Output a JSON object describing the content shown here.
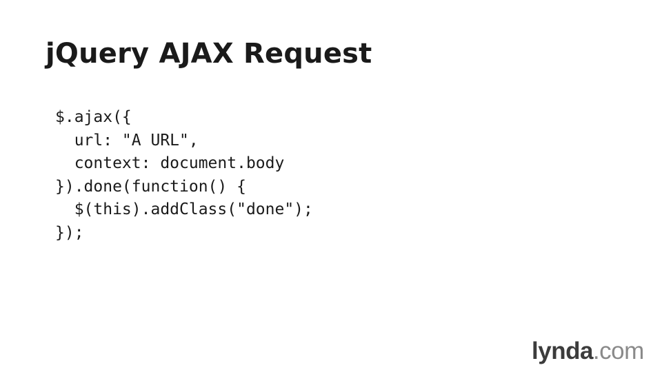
{
  "slide": {
    "title": "jQuery AJAX Request",
    "code_lines": [
      "$.ajax({",
      "  url: \"A URL\",",
      "  context: document.body",
      "}).done(function() {",
      "  $(this).addClass(\"done\");",
      "});"
    ]
  },
  "brand": {
    "name": "lynda",
    "tld": ".com"
  },
  "colors": {
    "background": "#ffffff",
    "text": "#1a1a1a",
    "brand_name": "#3c3c3c",
    "brand_tld": "#8a8a8a"
  }
}
